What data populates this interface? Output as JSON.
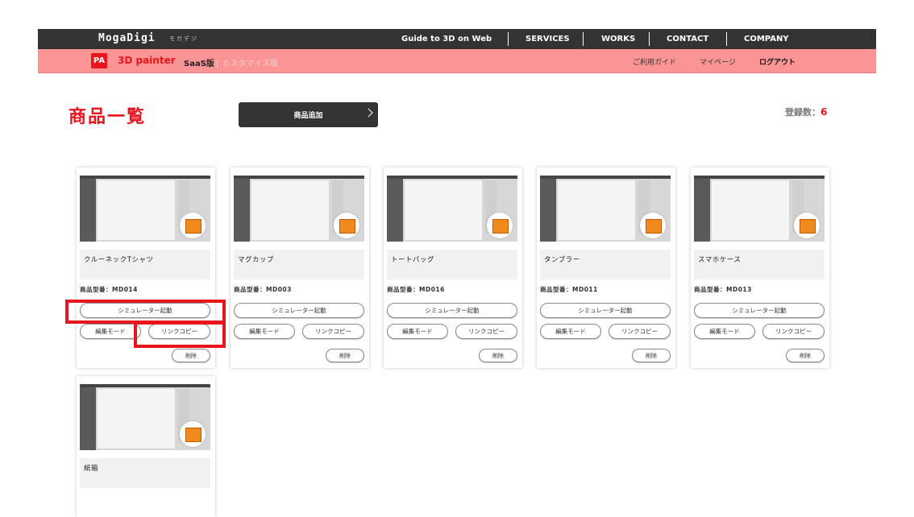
{
  "header": {
    "logo": "MogaDigi",
    "logo_sub": "モガデジ",
    "nav": [
      "Guide to 3D on Web",
      "SERVICES",
      "WORKS",
      "CONTACT",
      "COMPANY"
    ]
  },
  "subheader": {
    "badge": "PA",
    "app_name": "3D painter",
    "edition": "SaaS版",
    "edition_alt": "カスタマイズ版",
    "separator": "|",
    "links": [
      "ご利用ガイド",
      "マイページ",
      "ログアウト"
    ]
  },
  "page": {
    "title": "商品一覧",
    "add_button": "商品追加",
    "count_label": "登録数：",
    "count_value": "6"
  },
  "card_labels": {
    "simulator": "シミュレーター起動",
    "edit": "編集モード",
    "link_copy": "リンクコピー",
    "delete": "削除"
  },
  "products": [
    {
      "name": "クルーネックTシャツ",
      "model": "商品型番：MD014"
    },
    {
      "name": "マグカップ",
      "model": "商品型番：MD003"
    },
    {
      "name": "トートバッグ",
      "model": "商品型番：MD016"
    },
    {
      "name": "タンブラー",
      "model": "商品型番：MD011"
    },
    {
      "name": "スマホケース",
      "model": "商品型番：MD013"
    },
    {
      "name": "紙箱",
      "model": ""
    }
  ],
  "colors": {
    "accent": "#e8161c",
    "header_bg": "#333333",
    "subheader_bg": "#fb9595",
    "highlight": "#e8161c"
  }
}
